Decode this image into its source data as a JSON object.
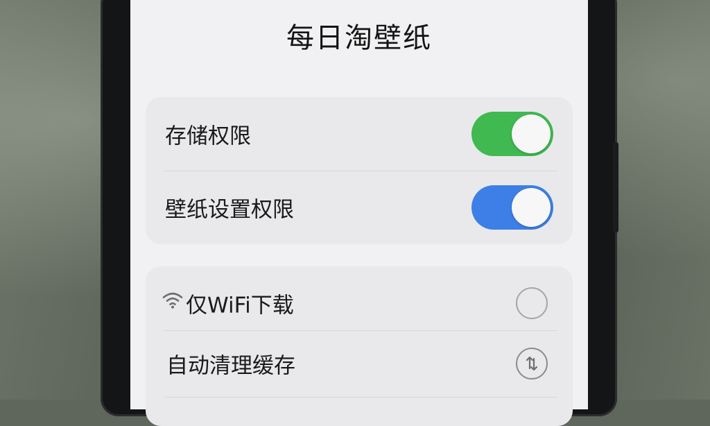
{
  "app": {
    "title": "每日淘壁纸"
  },
  "permissions": {
    "items": [
      {
        "label": "存储权限",
        "enabled": true,
        "color": "#3fb950"
      },
      {
        "label": "壁纸设置权限",
        "enabled": true,
        "color": "#3d7fe6"
      }
    ]
  },
  "settings": {
    "items": [
      {
        "label": "仅WiFi下载",
        "icon": "wifi-icon",
        "checked": false
      },
      {
        "label": "自动清理缓存",
        "icon": "sync-arrows-icon"
      }
    ]
  }
}
